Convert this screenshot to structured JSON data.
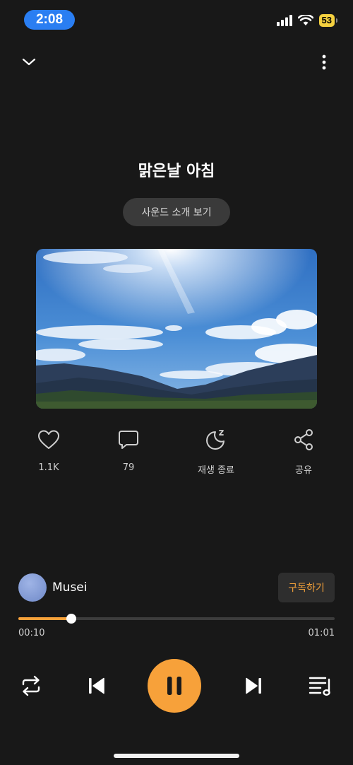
{
  "status_bar": {
    "time": "2:08",
    "battery": "53",
    "time_pill_color": "#2a7ef2",
    "battery_color": "#f4d03f"
  },
  "header": {
    "collapse_icon": "chevron-down-icon",
    "more_icon": "more-vertical-icon"
  },
  "track": {
    "title": "맑은날 아침",
    "intro_label": "사운드 소개 보기",
    "artwork": "sky-and-mountains-image"
  },
  "actions": [
    {
      "icon": "heart-icon",
      "label": "1.1K"
    },
    {
      "icon": "comment-icon",
      "label": "79"
    },
    {
      "icon": "sleep-moon-icon",
      "label": "재생 종료"
    },
    {
      "icon": "share-icon",
      "label": "공유"
    }
  ],
  "artist": {
    "name": "Musei",
    "subscribe_label": "구독하기"
  },
  "playback": {
    "current_time": "00:10",
    "duration": "01:01",
    "progress_fraction": 0.167,
    "accent_color": "#f7a13a"
  },
  "controls": {
    "repeat_icon": "repeat-icon",
    "previous_icon": "previous-track-icon",
    "pause_icon": "pause-icon",
    "next_icon": "next-track-icon",
    "playlist_icon": "playlist-icon"
  }
}
